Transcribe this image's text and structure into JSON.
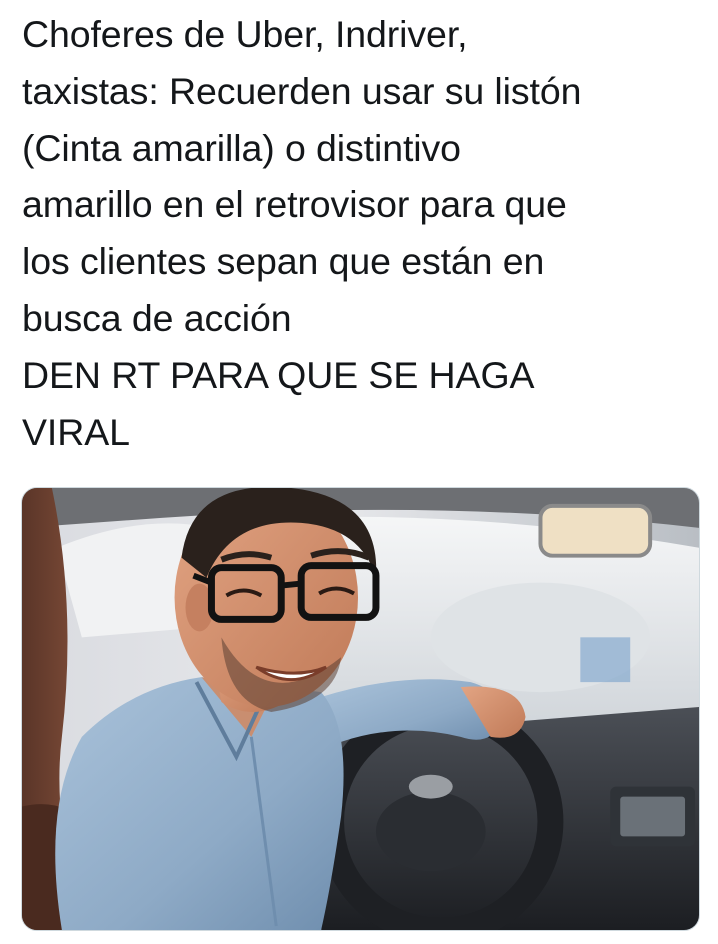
{
  "tweet": {
    "lines": [
      "Choferes de Uber, Indriver,",
      "taxistas: Recuerden usar su listón",
      "(Cinta amarilla) o distintivo",
      "amarillo en el retrovisor para que",
      "los clientes sepan que están en",
      "busca de acción",
      "DEN RT PARA QUE SE HAGA",
      "VIRAL"
    ]
  },
  "media": {
    "type": "photo",
    "subject": "smiling-driver-in-car"
  }
}
